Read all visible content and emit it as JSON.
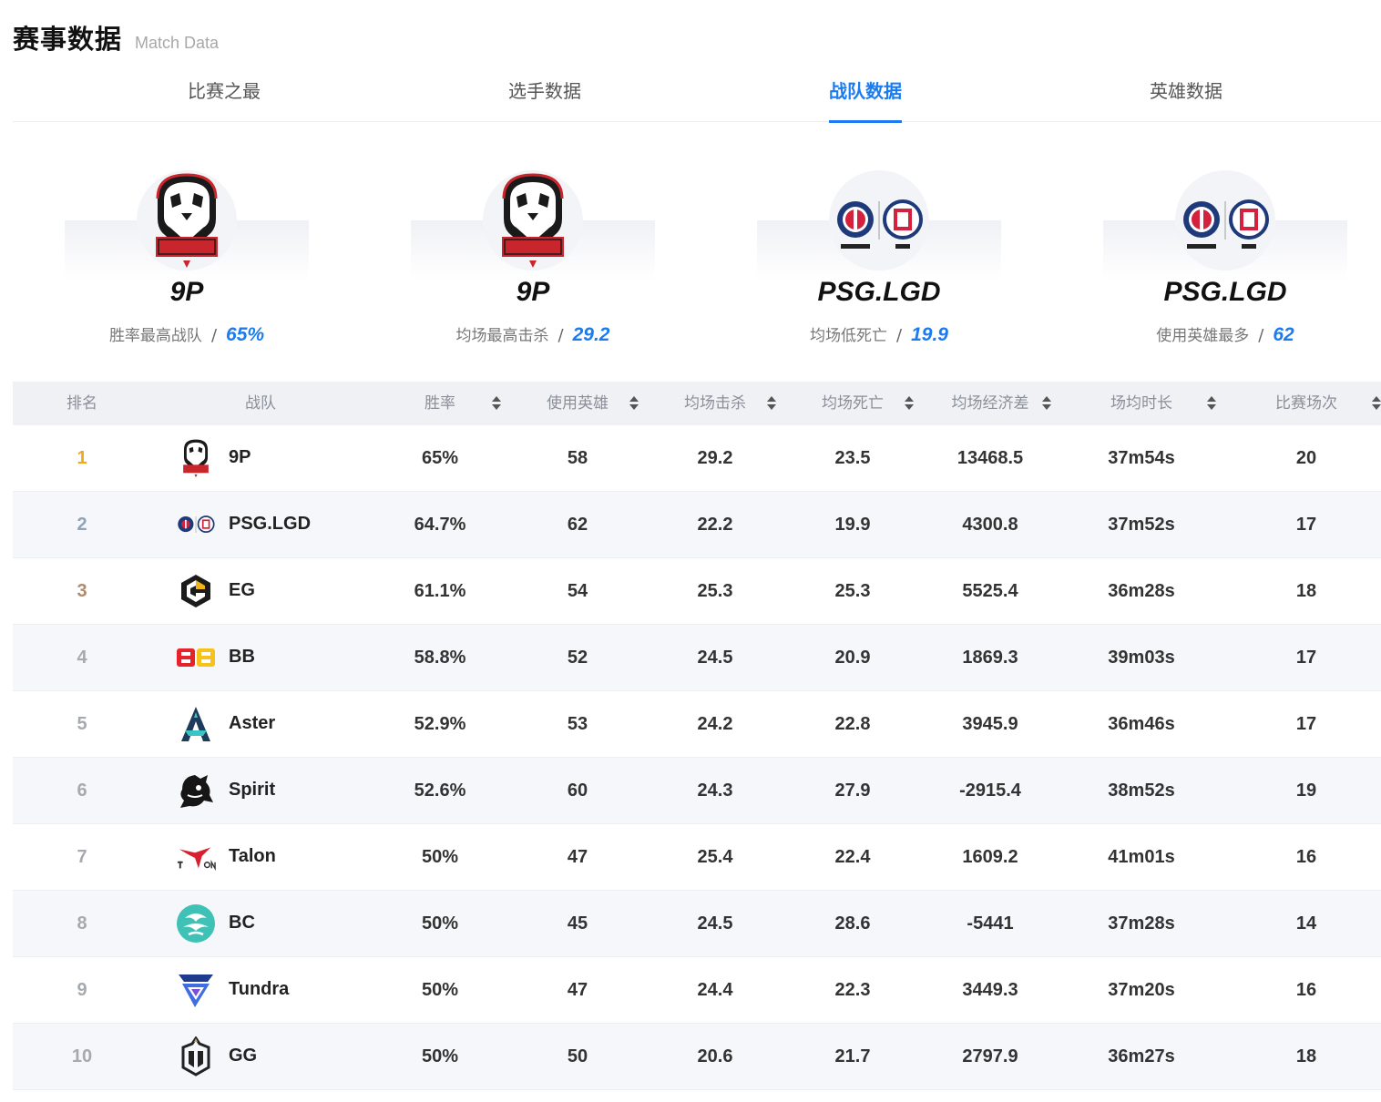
{
  "header": {
    "title": "赛事数据",
    "subtitle": "Match Data"
  },
  "tabs": [
    {
      "label": "比赛之最",
      "active": false
    },
    {
      "label": "选手数据",
      "active": false
    },
    {
      "label": "战队数据",
      "active": true
    },
    {
      "label": "英雄数据",
      "active": false
    }
  ],
  "highlights": [
    {
      "team": "9P",
      "label": "胜率最高战队",
      "value": "65%",
      "logo": "nine-pandas-logo"
    },
    {
      "team": "9P",
      "label": "均场最高击杀",
      "value": "29.2",
      "logo": "nine-pandas-logo"
    },
    {
      "team": "PSG.LGD",
      "label": "均场低死亡",
      "value": "19.9",
      "logo": "psg-lgd-logo"
    },
    {
      "team": "PSG.LGD",
      "label": "使用英雄最多",
      "value": "62",
      "logo": "psg-lgd-logo"
    }
  ],
  "separator": "/",
  "table": {
    "columns": [
      "排名",
      "战队",
      "胜率",
      "使用英雄",
      "均场击杀",
      "均场死亡",
      "均场经济差",
      "场均时长",
      "比赛场次"
    ],
    "rank_colors": {
      "1": "#f0a81e",
      "2": "#8fa3b8",
      "3": "#b08a6a",
      "default": "#a6a9ae"
    },
    "rows": [
      {
        "rank": "1",
        "team": "9P",
        "logo": "nine-pandas-logo",
        "winrate": "65%",
        "heroes": "58",
        "kills": "29.2",
        "deaths": "23.5",
        "gold_diff": "13468.5",
        "duration": "37m54s",
        "matches": "20"
      },
      {
        "rank": "2",
        "team": "PSG.LGD",
        "logo": "psg-lgd-logo",
        "winrate": "64.7%",
        "heroes": "62",
        "kills": "22.2",
        "deaths": "19.9",
        "gold_diff": "4300.8",
        "duration": "37m52s",
        "matches": "17"
      },
      {
        "rank": "3",
        "team": "EG",
        "logo": "eg-logo",
        "winrate": "61.1%",
        "heroes": "54",
        "kills": "25.3",
        "deaths": "25.3",
        "gold_diff": "5525.4",
        "duration": "36m28s",
        "matches": "18"
      },
      {
        "rank": "4",
        "team": "BB",
        "logo": "bb-logo",
        "winrate": "58.8%",
        "heroes": "52",
        "kills": "24.5",
        "deaths": "20.9",
        "gold_diff": "1869.3",
        "duration": "39m03s",
        "matches": "17"
      },
      {
        "rank": "5",
        "team": "Aster",
        "logo": "aster-logo",
        "winrate": "52.9%",
        "heroes": "53",
        "kills": "24.2",
        "deaths": "22.8",
        "gold_diff": "3945.9",
        "duration": "36m46s",
        "matches": "17"
      },
      {
        "rank": "6",
        "team": "Spirit",
        "logo": "spirit-logo",
        "winrate": "52.6%",
        "heroes": "60",
        "kills": "24.3",
        "deaths": "27.9",
        "gold_diff": "-2915.4",
        "duration": "38m52s",
        "matches": "19"
      },
      {
        "rank": "7",
        "team": "Talon",
        "logo": "talon-logo",
        "winrate": "50%",
        "heroes": "47",
        "kills": "25.4",
        "deaths": "22.4",
        "gold_diff": "1609.2",
        "duration": "41m01s",
        "matches": "16"
      },
      {
        "rank": "8",
        "team": "BC",
        "logo": "bc-logo",
        "winrate": "50%",
        "heroes": "45",
        "kills": "24.5",
        "deaths": "28.6",
        "gold_diff": "-5441",
        "duration": "37m28s",
        "matches": "14"
      },
      {
        "rank": "9",
        "team": "Tundra",
        "logo": "tundra-logo",
        "winrate": "50%",
        "heroes": "47",
        "kills": "24.4",
        "deaths": "22.3",
        "gold_diff": "3449.3",
        "duration": "37m20s",
        "matches": "16"
      },
      {
        "rank": "10",
        "team": "GG",
        "logo": "gg-logo",
        "winrate": "50%",
        "heroes": "50",
        "kills": "20.6",
        "deaths": "21.7",
        "gold_diff": "2797.9",
        "duration": "36m27s",
        "matches": "18"
      }
    ]
  }
}
